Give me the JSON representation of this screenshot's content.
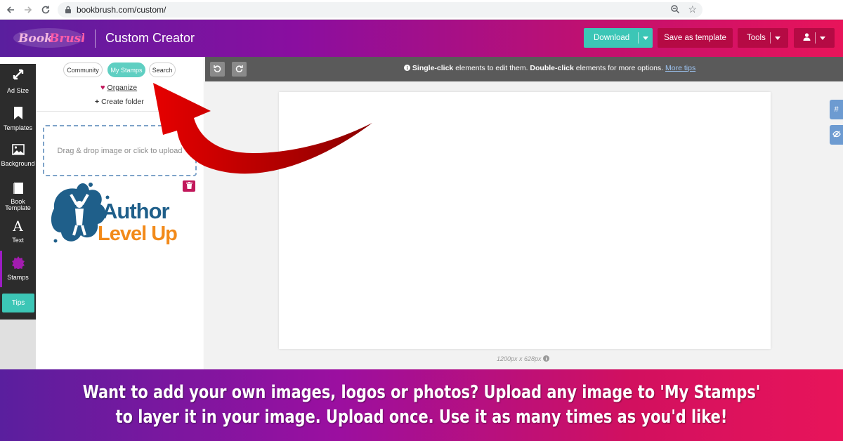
{
  "browser": {
    "url": "bookbrush.com/custom/"
  },
  "header": {
    "logo_text": "Book Brush",
    "title": "Custom Creator",
    "download_label": "Download",
    "save_template_label": "Save as template",
    "tools_label": "Tools"
  },
  "toolbar": {
    "items": [
      {
        "label": "Ad Size",
        "icon": "expand-arrows-icon"
      },
      {
        "label": "Templates",
        "icon": "bookmark-icon"
      },
      {
        "label": "Background",
        "icon": "image-icon"
      },
      {
        "label": "Book\nTemplate",
        "icon": "book-icon"
      },
      {
        "label": "Text",
        "icon": "text-icon"
      },
      {
        "label": "Stamps",
        "icon": "stamp-icon"
      }
    ],
    "active": "Stamps",
    "tips_label": "Tips"
  },
  "panel": {
    "tabs": [
      {
        "label": "Community"
      },
      {
        "label": "My Stamps"
      },
      {
        "label": "Search"
      }
    ],
    "active_tab": "My Stamps",
    "organize_label": "Organize",
    "create_folder_label": "Create folder",
    "dropzone_text": "Drag & drop image or click to upload",
    "stamp_logo_line1": "Author",
    "stamp_logo_line2": "Level Up"
  },
  "canvas": {
    "hint_bold1": "Single-click",
    "hint_mid": " elements to edit them. ",
    "hint_bold2": "Double-click",
    "hint_end": " elements for more options. ",
    "hint_link": "More tips",
    "size_label": "1200px x 628px"
  },
  "side_tabs": {
    "tab1": "#"
  },
  "caption": {
    "text": "Want to add your own images, logos or photos? Upload any image to 'My Stamps' to layer it in your image. Upload once. Use it as many times as you'd like!"
  },
  "colors": {
    "teal": "#3cc6b6",
    "crimson": "#b50a44",
    "arrow_red": "#c40000"
  }
}
